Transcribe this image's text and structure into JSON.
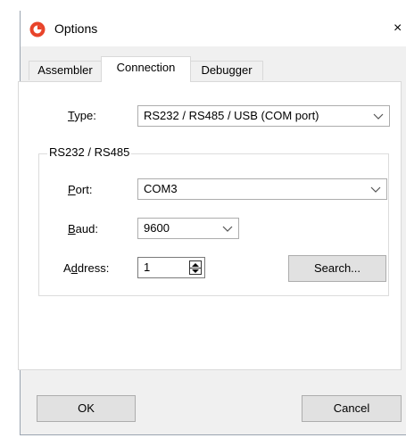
{
  "window": {
    "title": "Options",
    "close_glyph": "×"
  },
  "tabs": [
    {
      "label": "Assembler",
      "active": false
    },
    {
      "label": "Connection",
      "active": true
    },
    {
      "label": "Debugger",
      "active": false
    }
  ],
  "type_row": {
    "label_underlined": "T",
    "label_rest": "ype:",
    "value": "RS232 / RS485 / USB (COM port)"
  },
  "group": {
    "legend": "RS232 / RS485",
    "port": {
      "label_underlined": "P",
      "label_rest": "ort:",
      "value": "COM3"
    },
    "baud": {
      "label_underlined": "B",
      "label_rest": "aud:",
      "value": "9600"
    },
    "address": {
      "label_pre": "A",
      "label_underlined": "d",
      "label_rest": "dress:",
      "value": "1"
    },
    "search_label": "Search..."
  },
  "buttons": {
    "ok": "OK",
    "cancel": "Cancel"
  },
  "colors": {
    "accent_icon": "#e8442a"
  },
  "icons": {
    "app": "app-logo-icon",
    "chevron": "chevron-down-icon",
    "close": "close-icon"
  }
}
